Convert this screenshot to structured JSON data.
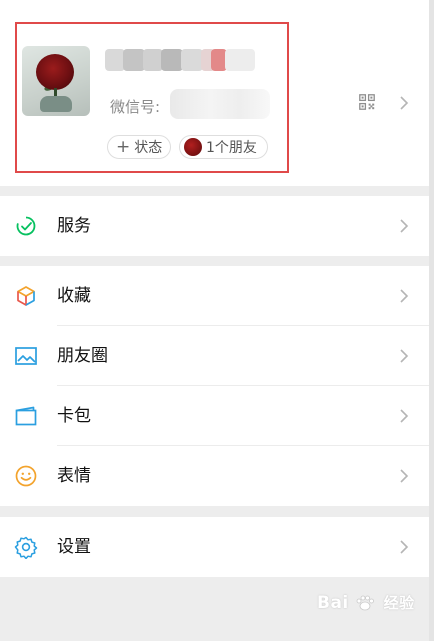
{
  "profile": {
    "wechat_id_label": "微信号:",
    "status_pill": "状态",
    "friends_pill": "1个朋友"
  },
  "menu": {
    "services": {
      "label": "服务",
      "icon": "services-icon"
    },
    "favorites": {
      "label": "收藏",
      "icon": "favorites-cube-icon"
    },
    "moments": {
      "label": "朋友圈",
      "icon": "moments-picture-icon"
    },
    "cards": {
      "label": "卡包",
      "icon": "card-wallet-icon"
    },
    "stickers": {
      "label": "表情",
      "icon": "smiley-icon"
    },
    "settings": {
      "label": "设置",
      "icon": "gear-icon"
    }
  },
  "colors": {
    "highlight_box": "#e04a4a",
    "services_green": "#07c160",
    "moments_blue": "#2b9fe0",
    "stickers_orange": "#f3a32c"
  },
  "watermark": {
    "text": "Bai",
    "suffix": "经验"
  }
}
